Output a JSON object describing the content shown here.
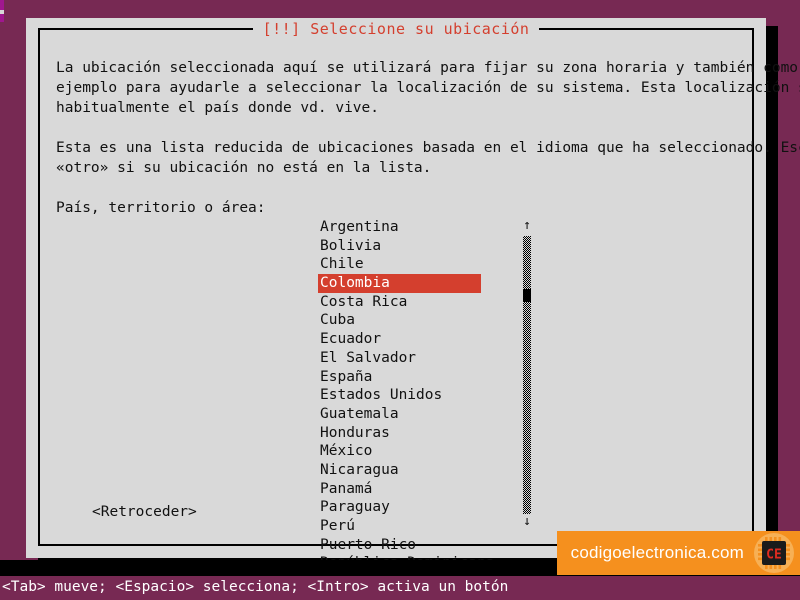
{
  "colors": {
    "desktop": "#772953",
    "dialog_bg": "#d9d9d9",
    "accent_red": "#d43f2e",
    "text": "#111111",
    "watermark_orange": "#f5901e",
    "watermark_logo_bg": "#f7b055",
    "statusbar_text": "#ffffff",
    "shadow": "#000000"
  },
  "dialog": {
    "title": "[!!] Seleccione su ubicación",
    "paragraph1": "La ubicación seleccionada aquí se utilizará para fijar su zona horaria y también como\nejemplo para ayudarle a seleccionar la localización de su sistema. Esta localización será\nhabitualmente el país donde vd. vive.",
    "paragraph2": "Esta es una lista reducida de ubicaciones basada en el idioma que ha seleccionado. Escoja\n«otro» si su ubicación no está en la lista.",
    "field_label": "País, territorio o área:",
    "back_button": "<Retroceder>"
  },
  "country_list": {
    "selected": "Colombia",
    "items": [
      "Argentina",
      "Bolivia",
      "Chile",
      "Colombia",
      "Costa Rica",
      "Cuba",
      "Ecuador",
      "El Salvador",
      "España",
      "Estados Unidos",
      "Guatemala",
      "Honduras",
      "México",
      "Nicaragua",
      "Panamá",
      "Paraguay",
      "Perú",
      "Puerto Rico",
      "República Dominicana"
    ]
  },
  "scrollbar": {
    "up_arrow": "↑",
    "down_arrow": "↓",
    "thumb_position_percent": 20
  },
  "statusbar": {
    "hint": "<Tab> mueve; <Espacio> selecciona; <Intro> activa un botón"
  },
  "watermark": {
    "text": "codigoelectronica.com",
    "logo_label": "CE",
    "logo_icon": "chip-icon"
  }
}
